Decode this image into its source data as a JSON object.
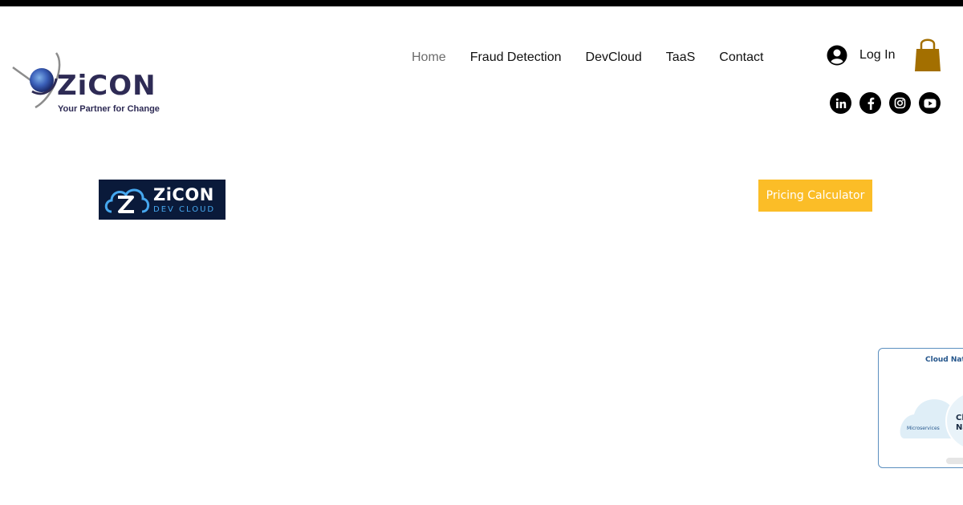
{
  "logo": {
    "word": "ZiCON",
    "tagline": "Your Partner for Change"
  },
  "nav": {
    "items": [
      {
        "label": "Home",
        "active": true
      },
      {
        "label": "Fraud Detection",
        "active": false
      },
      {
        "label": "DevCloud",
        "active": false
      },
      {
        "label": "TaaS",
        "active": false
      },
      {
        "label": "Contact",
        "active": false
      }
    ]
  },
  "login": {
    "label": "Log In"
  },
  "icons": {
    "user": "user-circle-icon",
    "cart": "shopping-bag-icon",
    "social": [
      "linkedin-icon",
      "facebook-icon",
      "instagram-icon",
      "youtube-icon"
    ]
  },
  "devcloud": {
    "title": "ZiCON",
    "subtitle": "DEV CLOUD"
  },
  "pricing": {
    "label": "Pricing Calculator"
  },
  "cloud_native": {
    "title": "Cloud Nativ",
    "micro": "Microservices",
    "center_line1": "Cl",
    "center_line2": "Na"
  },
  "colors": {
    "accent": "#fbbd27",
    "brand": "#2e2b55",
    "cart": "#a36f00",
    "banner_bg": "#0a1a3a"
  }
}
